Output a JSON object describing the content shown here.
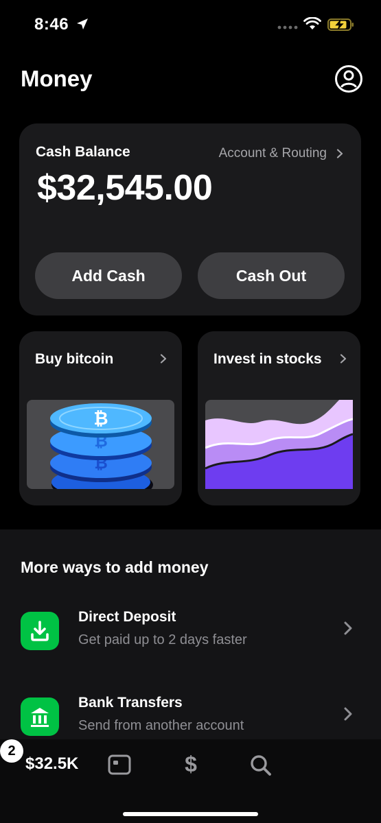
{
  "status_bar": {
    "time": "8:46"
  },
  "header": {
    "title": "Money"
  },
  "balance_card": {
    "label": "Cash Balance",
    "routing_link": "Account & Routing",
    "amount": "$32,545.00",
    "add_cash_label": "Add Cash",
    "cash_out_label": "Cash Out"
  },
  "tiles": {
    "bitcoin_title": "Buy bitcoin",
    "stocks_title": "Invest in stocks"
  },
  "more_ways": {
    "title": "More ways to add money",
    "items": [
      {
        "title": "Direct Deposit",
        "subtitle": "Get paid up to 2 days faster",
        "icon": "download-icon"
      },
      {
        "title": "Bank Transfers",
        "subtitle": "Send from another account",
        "icon": "bank-icon"
      }
    ]
  },
  "bottom_nav": {
    "balance": "$32.5K",
    "dollar_glyph": "$",
    "activity_count": "2"
  },
  "colors": {
    "accent_green": "#00c244",
    "card_bg": "#1a1a1c",
    "button_bg": "#3e3e41",
    "bitcoin_blue": "#1e8fff",
    "stocks_purple": "#7a4bff"
  }
}
